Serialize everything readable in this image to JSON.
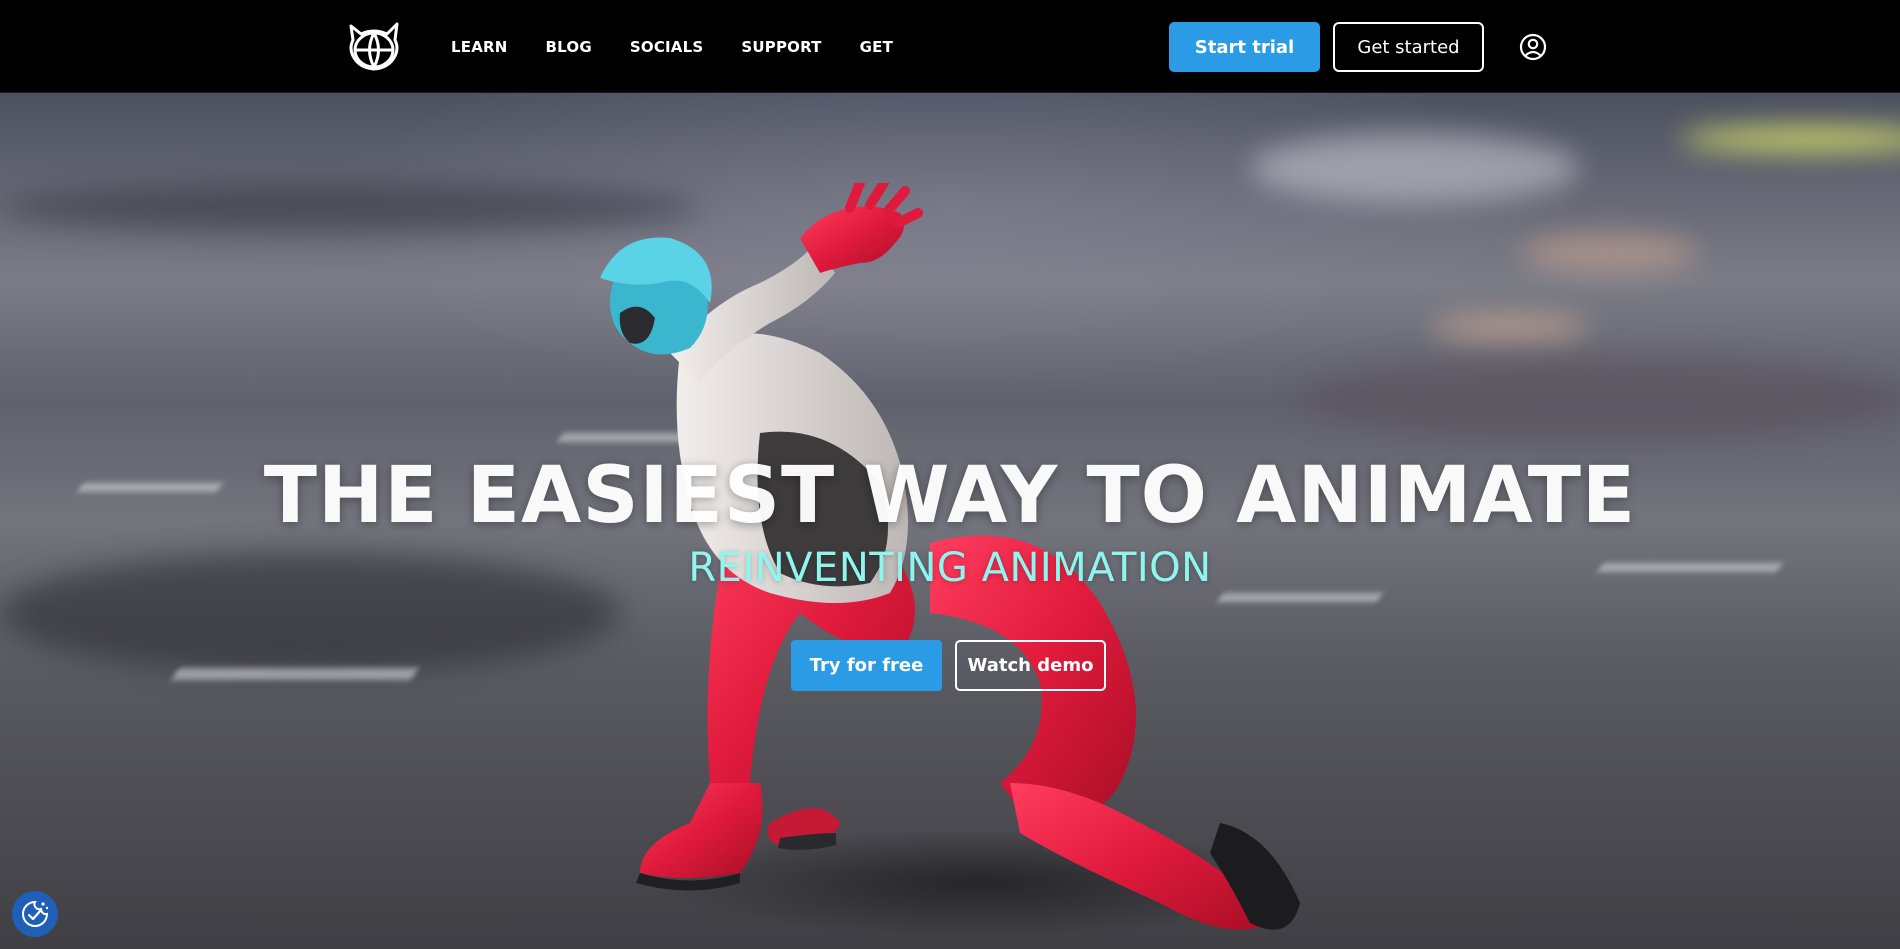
{
  "nav": {
    "links": [
      "LEARN",
      "BLOG",
      "SOCIALS",
      "SUPPORT",
      "GET"
    ],
    "start_trial_label": "Start trial",
    "get_started_label": "Get started"
  },
  "hero": {
    "title": "THE EASIEST WAY TO ANIMATE",
    "subtitle": "REINVENTING ANIMATION",
    "try_free_label": "Try for free",
    "watch_demo_label": "Watch demo"
  },
  "icons": {
    "logo": "cat-globe-logo-icon",
    "user": "user-account-icon",
    "cookie": "cookie-settings-icon"
  },
  "colors": {
    "accent": "#2b9be5",
    "subtitle": "#8ff5ef",
    "nav_bg": "#000000",
    "cookie_bg": "#1f5fb8"
  }
}
